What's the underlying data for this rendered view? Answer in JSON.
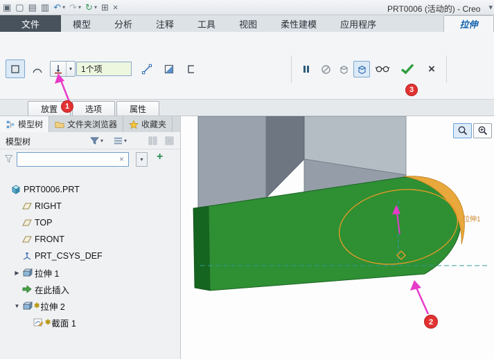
{
  "titlebar": {
    "title": "PRT0006 (活动的) - Creo",
    "right_glyph": "▾",
    "icons": [
      {
        "name": "app-icon",
        "glyph": "▣"
      },
      {
        "name": "new-icon",
        "glyph": "▢"
      },
      {
        "name": "open-icon",
        "glyph": "▤"
      },
      {
        "name": "save-icon",
        "glyph": "▥"
      },
      {
        "name": "undo-icon",
        "glyph": "↶"
      },
      {
        "name": "undo-dropdown-icon",
        "glyph": "▾"
      },
      {
        "name": "redo-icon",
        "glyph": "↷"
      },
      {
        "name": "redo-dropdown-icon",
        "glyph": "▾"
      },
      {
        "name": "regenerate-icon",
        "glyph": "↻"
      },
      {
        "name": "regenerate-dropdown-icon",
        "glyph": "▾"
      },
      {
        "name": "windows-icon",
        "glyph": "⊞"
      },
      {
        "name": "close-window-icon",
        "glyph": "×"
      }
    ]
  },
  "ribbon": {
    "tabs": [
      "文件",
      "模型",
      "分析",
      "注释",
      "工具",
      "视图",
      "柔性建模",
      "应用程序"
    ],
    "context_tab": "拉伸",
    "dashboard": {
      "depth_value": "1个项",
      "dropdown_glyph": "▾",
      "cancel_glyph": "×",
      "subtabs": [
        "放置",
        "选项",
        "属性"
      ]
    }
  },
  "callouts": {
    "one": "1",
    "two": "2",
    "three": "3"
  },
  "panel": {
    "tabs": [
      "模型树",
      "文件夹浏览器",
      "收藏夹"
    ],
    "header": "模型树",
    "search": {
      "value": "",
      "clear": "×",
      "dropdown": "▾",
      "add": "+"
    },
    "tree": [
      {
        "label": "PRT0006.PRT",
        "icon": "part-icon",
        "indent": 0,
        "expander": "",
        "marker": ""
      },
      {
        "label": "RIGHT",
        "icon": "datum-plane-icon",
        "indent": 1,
        "expander": "",
        "marker": ""
      },
      {
        "label": "TOP",
        "icon": "datum-plane-icon",
        "indent": 1,
        "expander": "",
        "marker": ""
      },
      {
        "label": "FRONT",
        "icon": "datum-plane-icon",
        "indent": 1,
        "expander": "",
        "marker": ""
      },
      {
        "label": "PRT_CSYS_DEF",
        "icon": "csys-icon",
        "indent": 1,
        "expander": "",
        "marker": ""
      },
      {
        "label": "拉伸 1",
        "icon": "extrude-icon",
        "indent": 1,
        "expander": "▶",
        "marker": ""
      },
      {
        "label": "在此插入",
        "icon": "insert-here-icon",
        "indent": 1,
        "expander": "",
        "marker": ""
      },
      {
        "label": "拉伸 2",
        "icon": "extrude-icon",
        "indent": 1,
        "expander": "▼",
        "marker": "✱"
      },
      {
        "label": "截面 1",
        "icon": "sketch-icon",
        "indent": 2,
        "expander": "",
        "marker": "✱"
      }
    ]
  },
  "viewport": {
    "feature_label": "拉伸1"
  },
  "colors": {
    "highlight_green_face": "#2e8f33",
    "preview_orange": "#e8a83c",
    "annotation_magenta": "#e83ac8",
    "callout_red": "#e23232",
    "ok_check_green": "#2f9e3f",
    "context_tab_blue": "#1565b0"
  }
}
